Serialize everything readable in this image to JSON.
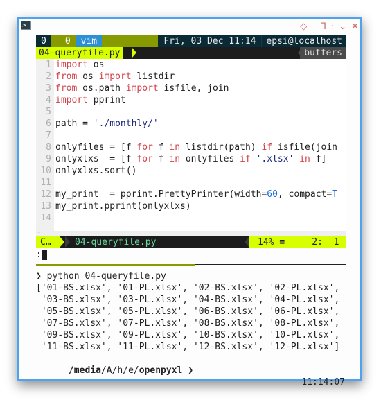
{
  "window": {
    "icon": "terminal-icon",
    "controls": [
      "pin-icon",
      "minimize-icon",
      "maximize-icon",
      "dot-icon",
      "shade-icon",
      "close-icon"
    ],
    "control_glyphs": [
      "◇",
      "_",
      "⅂",
      "·",
      "⌄",
      "✕"
    ],
    "frame_color": "#4da3f0"
  },
  "tmux": {
    "segments": [
      {
        "label": "0",
        "bg": "#0a2a36",
        "fg": "#ffffff"
      },
      {
        "label": "0",
        "bg": "#879a00",
        "fg": "#ffffff"
      },
      {
        "label": "vim",
        "bg": "#2d8fd6",
        "fg": "#ffffff"
      }
    ],
    "datetime": "Fri, 03 Dec 11:14",
    "host": "epsi@localhost"
  },
  "tabline": {
    "active_tab": "04-queryfile.py",
    "buffers_label": "buffers"
  },
  "editor": {
    "lines": [
      {
        "n": "1",
        "tokens": [
          {
            "t": "import",
            "c": "kw"
          },
          {
            "t": " os",
            "c": ""
          }
        ]
      },
      {
        "n": "2",
        "tokens": [
          {
            "t": "from",
            "c": "kw"
          },
          {
            "t": " os ",
            "c": ""
          },
          {
            "t": "import",
            "c": "kw"
          },
          {
            "t": " listdir",
            "c": ""
          }
        ]
      },
      {
        "n": "3",
        "tokens": [
          {
            "t": "from",
            "c": "kw"
          },
          {
            "t": " os.path ",
            "c": ""
          },
          {
            "t": "import",
            "c": "kw"
          },
          {
            "t": " isfile, join",
            "c": ""
          }
        ]
      },
      {
        "n": "4",
        "tokens": [
          {
            "t": "import",
            "c": "kw"
          },
          {
            "t": " pprint",
            "c": ""
          }
        ]
      },
      {
        "n": "5",
        "tokens": []
      },
      {
        "n": "6",
        "tokens": [
          {
            "t": "path = ",
            "c": ""
          },
          {
            "t": "'./monthly/'",
            "c": "str"
          }
        ]
      },
      {
        "n": "7",
        "tokens": []
      },
      {
        "n": "8",
        "tokens": [
          {
            "t": "onlyfiles = [f ",
            "c": ""
          },
          {
            "t": "for",
            "c": "kw"
          },
          {
            "t": " f ",
            "c": ""
          },
          {
            "t": "in",
            "c": "kw"
          },
          {
            "t": " listdir(path) ",
            "c": ""
          },
          {
            "t": "if",
            "c": "kw"
          },
          {
            "t": " isfile(join",
            "c": ""
          }
        ]
      },
      {
        "n": "9",
        "tokens": [
          {
            "t": "onlyxlxs  = [f ",
            "c": ""
          },
          {
            "t": "for",
            "c": "kw"
          },
          {
            "t": " f ",
            "c": ""
          },
          {
            "t": "in",
            "c": "kw"
          },
          {
            "t": " onlyfiles ",
            "c": ""
          },
          {
            "t": "if",
            "c": "kw"
          },
          {
            "t": " ",
            "c": ""
          },
          {
            "t": "'.xlsx'",
            "c": "str"
          },
          {
            "t": " ",
            "c": ""
          },
          {
            "t": "in",
            "c": "kw"
          },
          {
            "t": " f]",
            "c": ""
          }
        ]
      },
      {
        "n": "10",
        "tokens": [
          {
            "t": "onlyxlxs.sort()",
            "c": ""
          }
        ]
      },
      {
        "n": "11",
        "tokens": []
      },
      {
        "n": "12",
        "tokens": [
          {
            "t": "my_print  = pprint.PrettyPrinter(width=",
            "c": ""
          },
          {
            "t": "60",
            "c": "num"
          },
          {
            "t": ", compact=",
            "c": ""
          },
          {
            "t": "T",
            "c": "num"
          }
        ]
      },
      {
        "n": "13",
        "tokens": [
          {
            "t": "my_print.pprint(onlyxlxs)",
            "c": ""
          }
        ]
      },
      {
        "n": "14",
        "tokens": []
      }
    ],
    "tilde": "~"
  },
  "statusline": {
    "mode": "C…",
    "filename": "04-queryfile.py",
    "percent": "14%",
    "percent_icon": "≡",
    "position": "2:  1"
  },
  "cmdline": {
    "prefix": ":"
  },
  "shell": {
    "command_prompt": "❯",
    "command": "python 04-queryfile.py",
    "output": [
      "['01-BS.xlsx', '01-PL.xlsx', '02-BS.xlsx', '02-PL.xlsx',",
      " '03-BS.xlsx', '03-PL.xlsx', '04-BS.xlsx', '04-PL.xlsx',",
      " '05-BS.xlsx', '05-PL.xlsx', '06-BS.xlsx', '06-PL.xlsx',",
      " '07-BS.xlsx', '07-PL.xlsx', '08-BS.xlsx', '08-PL.xlsx',",
      " '09-BS.xlsx', '09-PL.xlsx', '10-BS.xlsx', '10-PL.xlsx',",
      " '11-BS.xlsx', '11-PL.xlsx', '12-BS.xlsx', '12-PL.xlsx']"
    ],
    "prompt_path_parts": [
      {
        "t": "/media",
        "bold": true
      },
      {
        "t": "/A/h/e/",
        "bold": false
      },
      {
        "t": "openpyxl",
        "bold": true
      }
    ],
    "prompt_symbol": "❯",
    "time": "11:14:07"
  }
}
